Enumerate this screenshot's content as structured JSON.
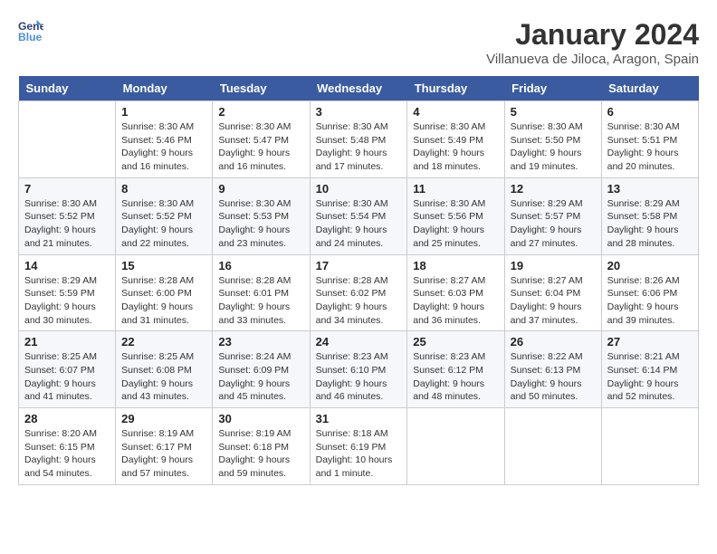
{
  "header": {
    "logo_line1": "General",
    "logo_line2": "Blue",
    "month_title": "January 2024",
    "subtitle": "Villanueva de Jiloca, Aragon, Spain"
  },
  "days_of_week": [
    "Sunday",
    "Monday",
    "Tuesday",
    "Wednesday",
    "Thursday",
    "Friday",
    "Saturday"
  ],
  "weeks": [
    [
      {
        "day": "",
        "sunrise": "",
        "sunset": "",
        "daylight": ""
      },
      {
        "day": "1",
        "sunrise": "Sunrise: 8:30 AM",
        "sunset": "Sunset: 5:46 PM",
        "daylight": "Daylight: 9 hours and 16 minutes."
      },
      {
        "day": "2",
        "sunrise": "Sunrise: 8:30 AM",
        "sunset": "Sunset: 5:47 PM",
        "daylight": "Daylight: 9 hours and 16 minutes."
      },
      {
        "day": "3",
        "sunrise": "Sunrise: 8:30 AM",
        "sunset": "Sunset: 5:48 PM",
        "daylight": "Daylight: 9 hours and 17 minutes."
      },
      {
        "day": "4",
        "sunrise": "Sunrise: 8:30 AM",
        "sunset": "Sunset: 5:49 PM",
        "daylight": "Daylight: 9 hours and 18 minutes."
      },
      {
        "day": "5",
        "sunrise": "Sunrise: 8:30 AM",
        "sunset": "Sunset: 5:50 PM",
        "daylight": "Daylight: 9 hours and 19 minutes."
      },
      {
        "day": "6",
        "sunrise": "Sunrise: 8:30 AM",
        "sunset": "Sunset: 5:51 PM",
        "daylight": "Daylight: 9 hours and 20 minutes."
      }
    ],
    [
      {
        "day": "7",
        "sunrise": "Sunrise: 8:30 AM",
        "sunset": "Sunset: 5:52 PM",
        "daylight": "Daylight: 9 hours and 21 minutes."
      },
      {
        "day": "8",
        "sunrise": "Sunrise: 8:30 AM",
        "sunset": "Sunset: 5:52 PM",
        "daylight": "Daylight: 9 hours and 22 minutes."
      },
      {
        "day": "9",
        "sunrise": "Sunrise: 8:30 AM",
        "sunset": "Sunset: 5:53 PM",
        "daylight": "Daylight: 9 hours and 23 minutes."
      },
      {
        "day": "10",
        "sunrise": "Sunrise: 8:30 AM",
        "sunset": "Sunset: 5:54 PM",
        "daylight": "Daylight: 9 hours and 24 minutes."
      },
      {
        "day": "11",
        "sunrise": "Sunrise: 8:30 AM",
        "sunset": "Sunset: 5:56 PM",
        "daylight": "Daylight: 9 hours and 25 minutes."
      },
      {
        "day": "12",
        "sunrise": "Sunrise: 8:29 AM",
        "sunset": "Sunset: 5:57 PM",
        "daylight": "Daylight: 9 hours and 27 minutes."
      },
      {
        "day": "13",
        "sunrise": "Sunrise: 8:29 AM",
        "sunset": "Sunset: 5:58 PM",
        "daylight": "Daylight: 9 hours and 28 minutes."
      }
    ],
    [
      {
        "day": "14",
        "sunrise": "Sunrise: 8:29 AM",
        "sunset": "Sunset: 5:59 PM",
        "daylight": "Daylight: 9 hours and 30 minutes."
      },
      {
        "day": "15",
        "sunrise": "Sunrise: 8:28 AM",
        "sunset": "Sunset: 6:00 PM",
        "daylight": "Daylight: 9 hours and 31 minutes."
      },
      {
        "day": "16",
        "sunrise": "Sunrise: 8:28 AM",
        "sunset": "Sunset: 6:01 PM",
        "daylight": "Daylight: 9 hours and 33 minutes."
      },
      {
        "day": "17",
        "sunrise": "Sunrise: 8:28 AM",
        "sunset": "Sunset: 6:02 PM",
        "daylight": "Daylight: 9 hours and 34 minutes."
      },
      {
        "day": "18",
        "sunrise": "Sunrise: 8:27 AM",
        "sunset": "Sunset: 6:03 PM",
        "daylight": "Daylight: 9 hours and 36 minutes."
      },
      {
        "day": "19",
        "sunrise": "Sunrise: 8:27 AM",
        "sunset": "Sunset: 6:04 PM",
        "daylight": "Daylight: 9 hours and 37 minutes."
      },
      {
        "day": "20",
        "sunrise": "Sunrise: 8:26 AM",
        "sunset": "Sunset: 6:06 PM",
        "daylight": "Daylight: 9 hours and 39 minutes."
      }
    ],
    [
      {
        "day": "21",
        "sunrise": "Sunrise: 8:25 AM",
        "sunset": "Sunset: 6:07 PM",
        "daylight": "Daylight: 9 hours and 41 minutes."
      },
      {
        "day": "22",
        "sunrise": "Sunrise: 8:25 AM",
        "sunset": "Sunset: 6:08 PM",
        "daylight": "Daylight: 9 hours and 43 minutes."
      },
      {
        "day": "23",
        "sunrise": "Sunrise: 8:24 AM",
        "sunset": "Sunset: 6:09 PM",
        "daylight": "Daylight: 9 hours and 45 minutes."
      },
      {
        "day": "24",
        "sunrise": "Sunrise: 8:23 AM",
        "sunset": "Sunset: 6:10 PM",
        "daylight": "Daylight: 9 hours and 46 minutes."
      },
      {
        "day": "25",
        "sunrise": "Sunrise: 8:23 AM",
        "sunset": "Sunset: 6:12 PM",
        "daylight": "Daylight: 9 hours and 48 minutes."
      },
      {
        "day": "26",
        "sunrise": "Sunrise: 8:22 AM",
        "sunset": "Sunset: 6:13 PM",
        "daylight": "Daylight: 9 hours and 50 minutes."
      },
      {
        "day": "27",
        "sunrise": "Sunrise: 8:21 AM",
        "sunset": "Sunset: 6:14 PM",
        "daylight": "Daylight: 9 hours and 52 minutes."
      }
    ],
    [
      {
        "day": "28",
        "sunrise": "Sunrise: 8:20 AM",
        "sunset": "Sunset: 6:15 PM",
        "daylight": "Daylight: 9 hours and 54 minutes."
      },
      {
        "day": "29",
        "sunrise": "Sunrise: 8:19 AM",
        "sunset": "Sunset: 6:17 PM",
        "daylight": "Daylight: 9 hours and 57 minutes."
      },
      {
        "day": "30",
        "sunrise": "Sunrise: 8:19 AM",
        "sunset": "Sunset: 6:18 PM",
        "daylight": "Daylight: 9 hours and 59 minutes."
      },
      {
        "day": "31",
        "sunrise": "Sunrise: 8:18 AM",
        "sunset": "Sunset: 6:19 PM",
        "daylight": "Daylight: 10 hours and 1 minute."
      },
      {
        "day": "",
        "sunrise": "",
        "sunset": "",
        "daylight": ""
      },
      {
        "day": "",
        "sunrise": "",
        "sunset": "",
        "daylight": ""
      },
      {
        "day": "",
        "sunrise": "",
        "sunset": "",
        "daylight": ""
      }
    ]
  ]
}
